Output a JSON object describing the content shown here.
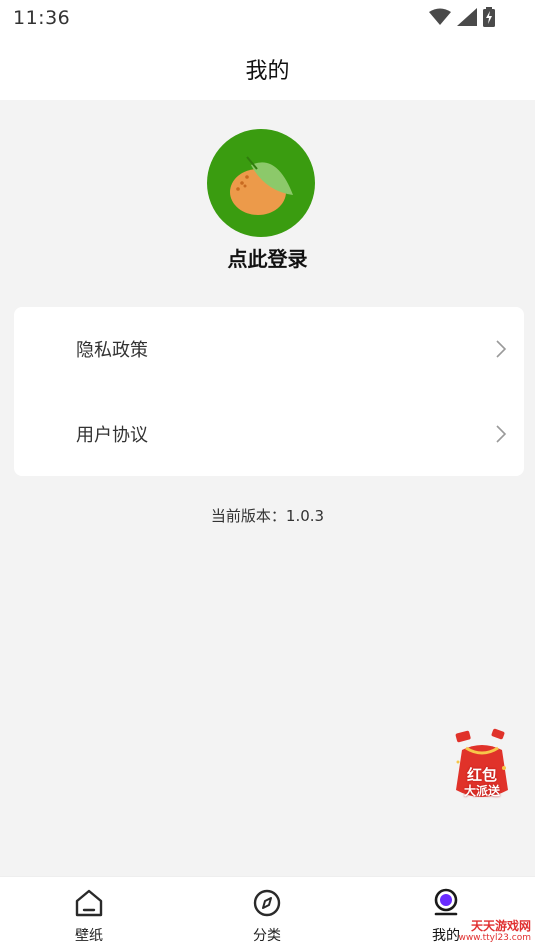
{
  "status_bar": {
    "time": "11:36",
    "icons": [
      "wifi-icon",
      "signal-icon",
      "battery-charging-icon"
    ]
  },
  "header": {
    "title": "我的"
  },
  "profile": {
    "avatar_icon": "tangerine-icon",
    "login_label": "点此登录"
  },
  "menu": {
    "items": [
      {
        "label": "隐私政策",
        "icon": "chevron-right-icon"
      },
      {
        "label": "用户协议",
        "icon": "chevron-right-icon"
      }
    ]
  },
  "version_text": "当前版本：1.0.3",
  "promo": {
    "line1": "红包",
    "line2": "大派送"
  },
  "tabs": [
    {
      "label": "壁纸",
      "icon": "home-icon",
      "active": false
    },
    {
      "label": "分类",
      "icon": "compass-icon",
      "active": false
    },
    {
      "label": "我的",
      "icon": "profile-icon",
      "active": true
    }
  ],
  "watermark": {
    "title": "天天游戏网",
    "url": "www.ttyl23.com"
  },
  "colors": {
    "accent_green": "#3a9c10",
    "orange": "#ec9a4a",
    "background": "#f3f3f3",
    "promo_red": "#e0322a",
    "active_tab": "#6a2cff"
  }
}
